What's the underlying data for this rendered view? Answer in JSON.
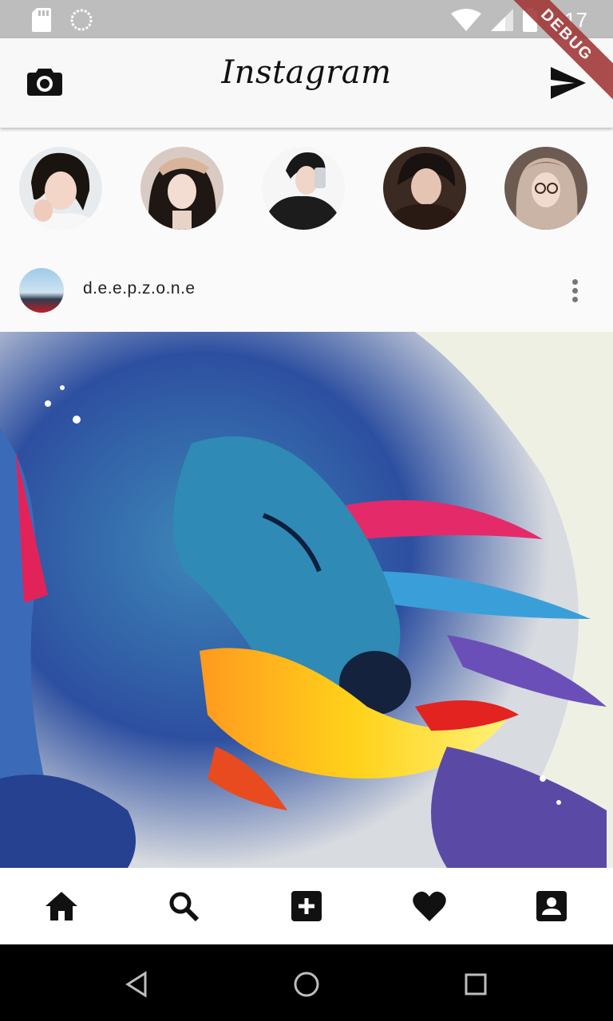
{
  "status_bar": {
    "time": "6:17",
    "icons": [
      "sd-card-icon",
      "sync-icon",
      "wifi-icon",
      "signal-icon",
      "battery-icon"
    ]
  },
  "debug_banner": "DEBUG",
  "app_bar": {
    "title": "Instagram",
    "left_icon": "camera-icon",
    "right_icon": "send-icon"
  },
  "stories": [
    {
      "name": "story-1"
    },
    {
      "name": "story-2"
    },
    {
      "name": "story-3"
    },
    {
      "name": "story-4"
    },
    {
      "name": "story-5"
    }
  ],
  "post": {
    "username": "d.e.e.p.z.o.n.e",
    "menu_icon": "more-vertical-icon",
    "image_icon": "horse-painting"
  },
  "bottom_nav": [
    "home-icon",
    "search-icon",
    "add-box-icon",
    "heart-icon",
    "account-box-icon"
  ],
  "system_nav": [
    "back-icon",
    "home-circle-icon",
    "recents-icon"
  ],
  "colors": {
    "status_bar": "#bdbdbd",
    "app_bar": "#f8f8f8",
    "background": "#fafafa",
    "debug": "#a33a3a"
  }
}
